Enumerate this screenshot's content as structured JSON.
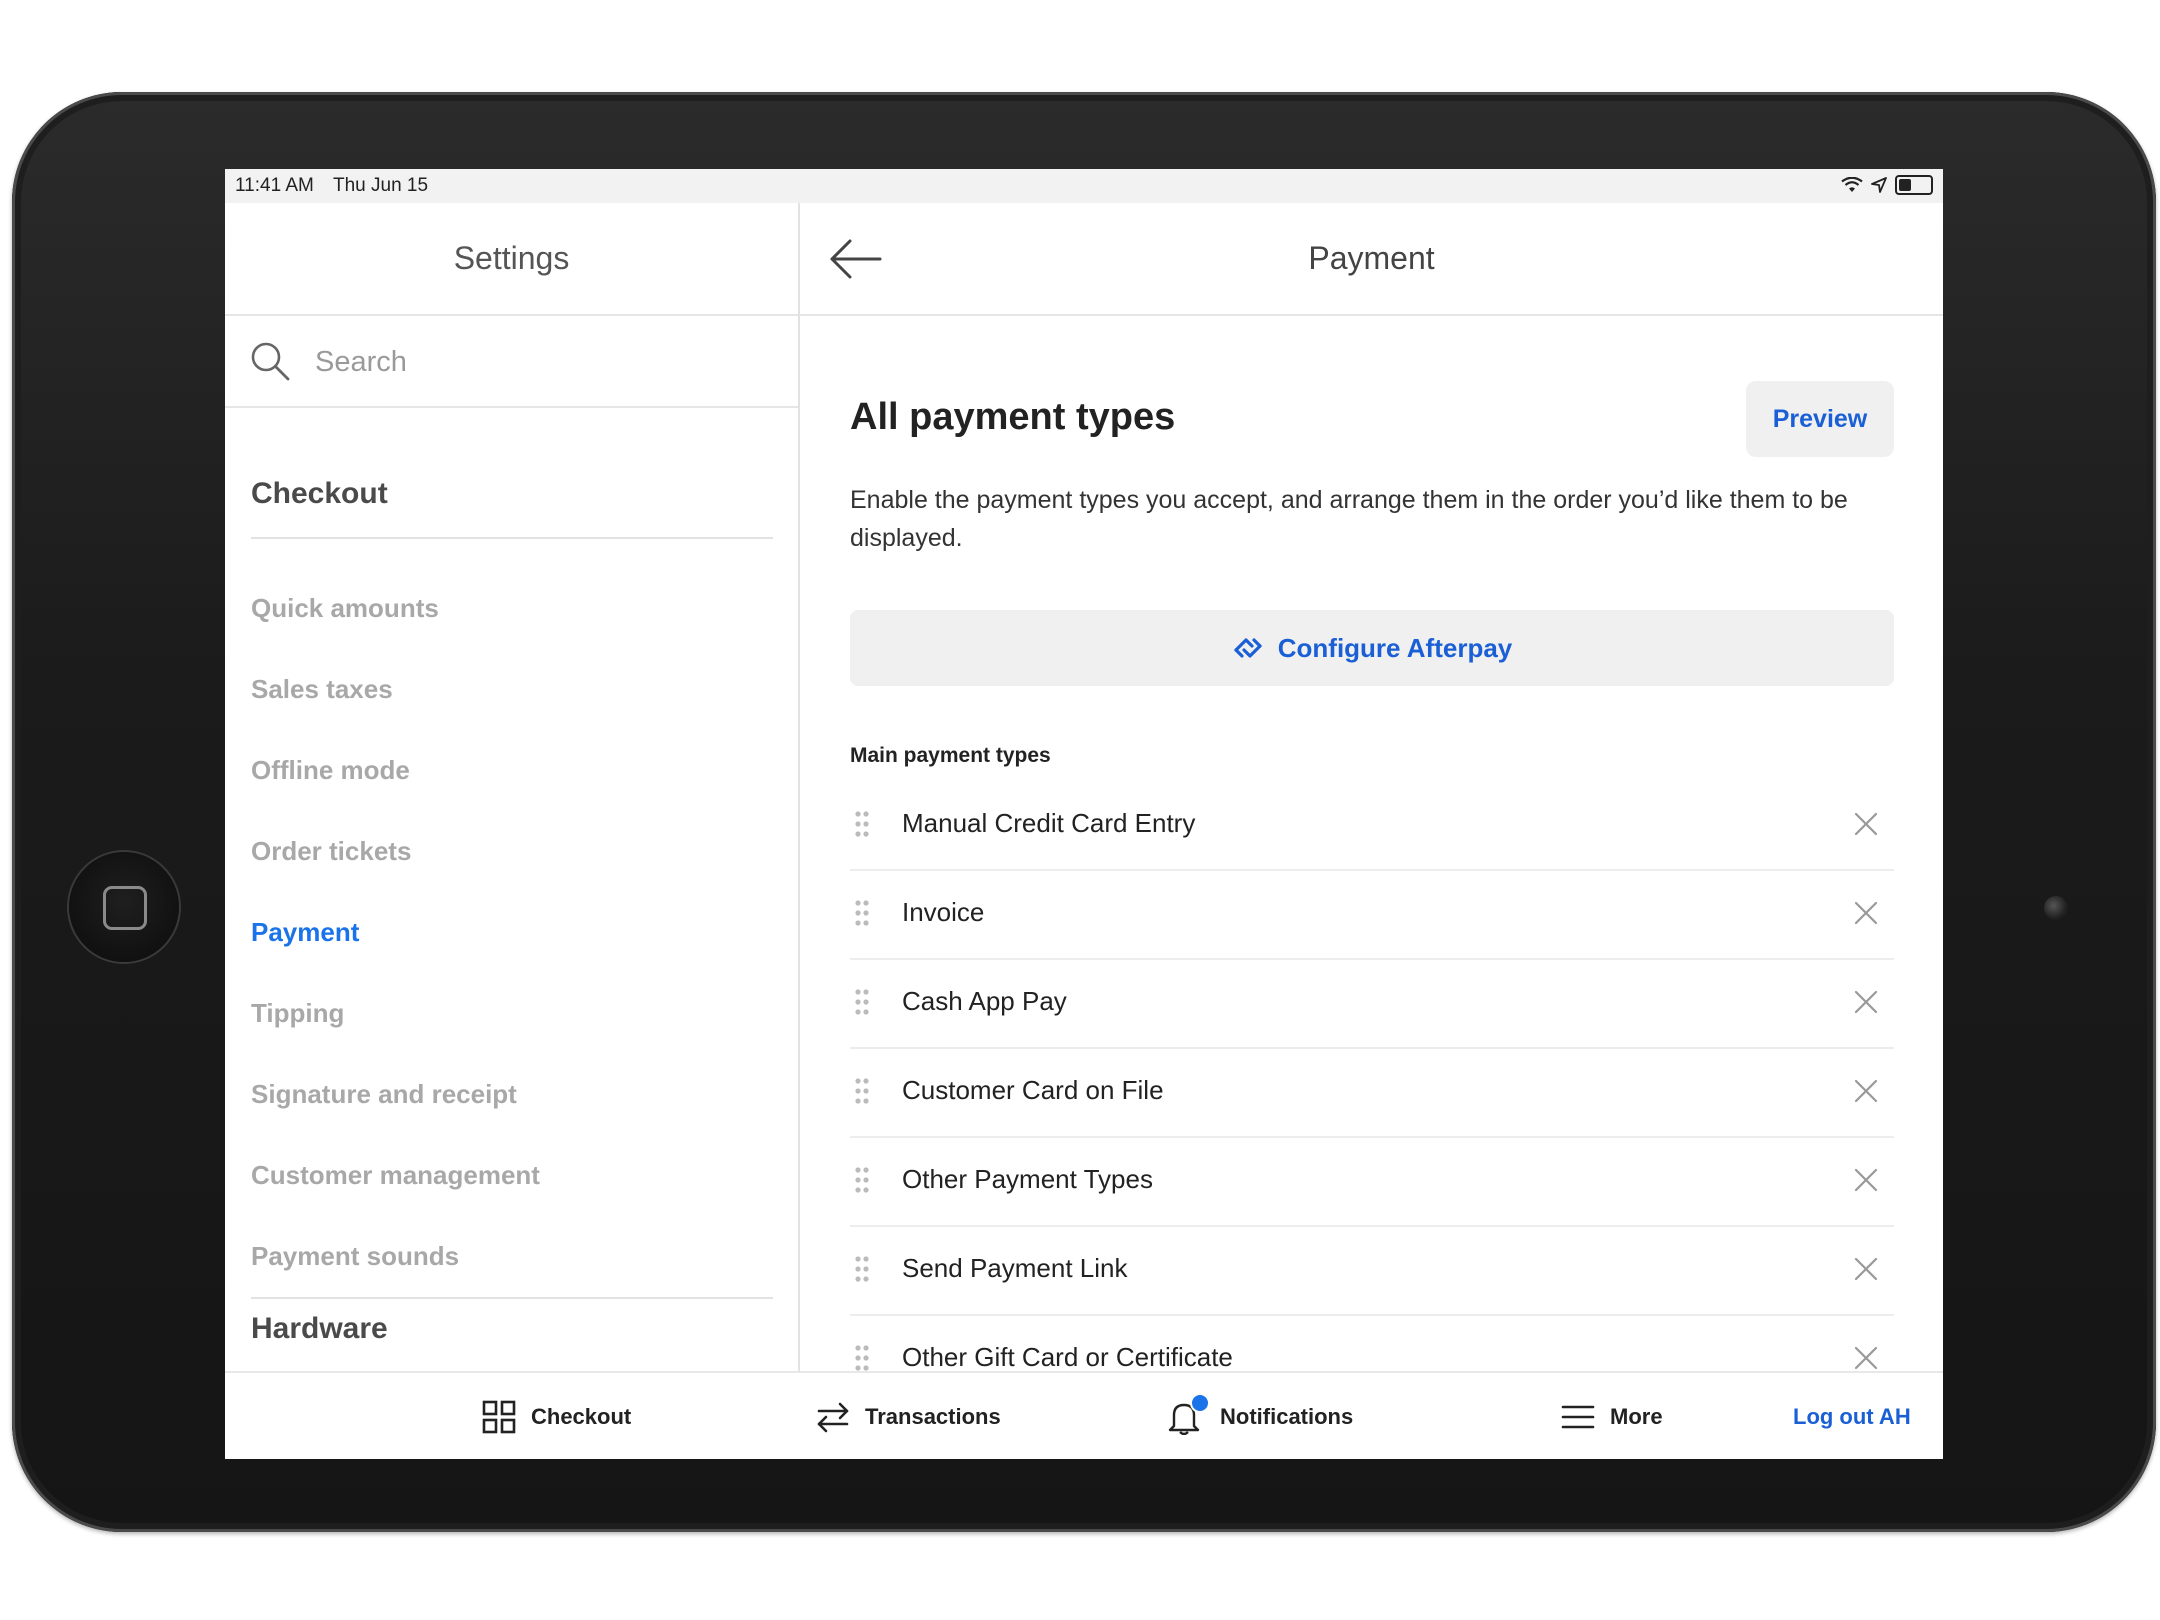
{
  "status_bar": {
    "time": "11:41 AM",
    "date": "Thu Jun 15"
  },
  "left_pane": {
    "title": "Settings",
    "search": {
      "placeholder": "Search"
    },
    "sections": [
      {
        "heading": "Checkout",
        "items": [
          {
            "label": "Quick amounts",
            "active": false
          },
          {
            "label": "Sales taxes",
            "active": false
          },
          {
            "label": "Offline mode",
            "active": false
          },
          {
            "label": "Order tickets",
            "active": false
          },
          {
            "label": "Payment",
            "active": true
          },
          {
            "label": "Tipping",
            "active": false
          },
          {
            "label": "Signature and receipt",
            "active": false
          },
          {
            "label": "Customer management",
            "active": false
          },
          {
            "label": "Payment sounds",
            "active": false
          }
        ]
      },
      {
        "heading": "Hardware",
        "items": []
      }
    ]
  },
  "right_pane": {
    "title": "Payment",
    "content_title": "All payment types",
    "preview_label": "Preview",
    "description": "Enable the payment types you accept, and arrange them in the order you’d like them to be displayed.",
    "afterpay_label": "Configure Afterpay",
    "main_heading": "Main payment types",
    "payment_types": [
      "Manual Credit Card Entry",
      "Invoice",
      "Cash App Pay",
      "Customer Card on File",
      "Other Payment Types",
      "Send Payment Link",
      "Other Gift Card or Certificate"
    ]
  },
  "tab_bar": {
    "tabs": [
      {
        "label": "Checkout",
        "icon": "grid-icon"
      },
      {
        "label": "Transactions",
        "icon": "swap-arrows-icon"
      },
      {
        "label": "Notifications",
        "icon": "bell-icon",
        "badge": true
      },
      {
        "label": "More",
        "icon": "hamburger-menu-icon"
      }
    ],
    "logout_label": "Log out AH"
  },
  "colors": {
    "accent": "#1a73e8",
    "link": "#1a5fd6",
    "muted": "#a8a8a8",
    "badge": "#1a73e8"
  }
}
